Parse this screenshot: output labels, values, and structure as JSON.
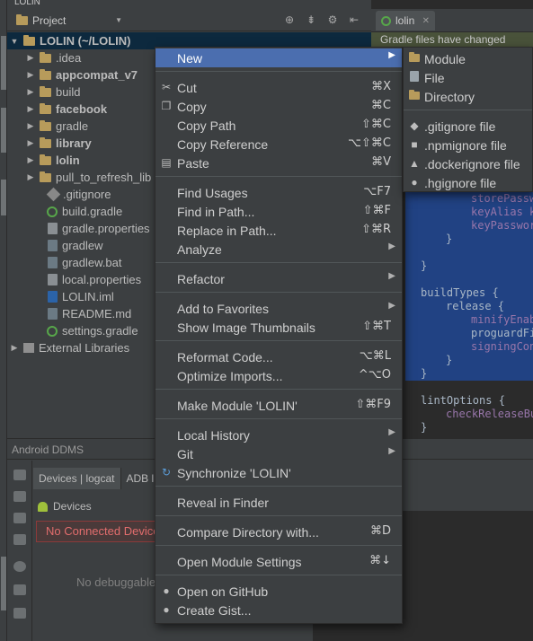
{
  "window_title": "LOLIN",
  "project_panel": {
    "view_selector": "Project",
    "tree": [
      {
        "label": "LOLIN (~/LOLIN)",
        "type": "root",
        "expanded": true
      },
      {
        "label": ".idea",
        "type": "folder"
      },
      {
        "label": "appcompat_v7",
        "type": "module"
      },
      {
        "label": "build",
        "type": "folder"
      },
      {
        "label": "facebook",
        "type": "module"
      },
      {
        "label": "gradle",
        "type": "folder"
      },
      {
        "label": "library",
        "type": "module"
      },
      {
        "label": "lolin",
        "type": "module"
      },
      {
        "label": "pull_to_refresh_lib",
        "type": "folder"
      },
      {
        "label": ".gitignore",
        "type": "git"
      },
      {
        "label": "build.gradle",
        "type": "gradle"
      },
      {
        "label": "gradle.properties",
        "type": "properties"
      },
      {
        "label": "gradlew",
        "type": "file"
      },
      {
        "label": "gradlew.bat",
        "type": "file"
      },
      {
        "label": "local.properties",
        "type": "properties"
      },
      {
        "label": "LOLIN.iml",
        "type": "iml"
      },
      {
        "label": "README.md",
        "type": "file"
      },
      {
        "label": "settings.gradle",
        "type": "gradle"
      },
      {
        "label": "External Libraries",
        "type": "libraries"
      }
    ]
  },
  "editor": {
    "tab_label": "lolin",
    "banner": "Gradle files have changed",
    "code_lines": [
      {
        "text": "storePassw",
        "style": "purple"
      },
      {
        "text": "keyAlias k",
        "style": "purple"
      },
      {
        "text": "keyPasswor",
        "style": "purple"
      },
      {
        "text": "}",
        "style": "plain"
      },
      {
        "text": "}",
        "style": "plain"
      },
      {
        "text": "buildTypes {",
        "style": "plain"
      },
      {
        "text": "release {",
        "style": "plain"
      },
      {
        "text": "minifyEnab",
        "style": "purple"
      },
      {
        "text": "proguardFi",
        "style": "plain"
      },
      {
        "text": "signingCon",
        "style": "purple"
      },
      {
        "text": "}",
        "style": "plain"
      },
      {
        "text": "}",
        "style": "plain"
      },
      {
        "text": "lintOptions {",
        "style": "plain"
      },
      {
        "text": "checkReleaseBu",
        "style": "purple"
      },
      {
        "text": "}",
        "style": "plain"
      }
    ]
  },
  "ddms": {
    "title": "Android DDMS",
    "tabs": [
      "Devices | logcat",
      "ADB l"
    ],
    "devices_header": "Devices",
    "no_device": "No Connected Devices",
    "no_debuggable": "No debuggable"
  },
  "context_menu": {
    "items": [
      {
        "label": "New",
        "submenu": true,
        "selected": true
      },
      {
        "label": "Cut",
        "shortcut": "⌘X",
        "icon": "✂"
      },
      {
        "label": "Copy",
        "shortcut": "⌘C",
        "icon": "❐"
      },
      {
        "label": "Copy Path",
        "shortcut": "⇧⌘C"
      },
      {
        "label": "Copy Reference",
        "shortcut": "⌥⇧⌘C"
      },
      {
        "label": "Paste",
        "shortcut": "⌘V",
        "icon": "📋"
      },
      {
        "label": "Find Usages",
        "shortcut": "⌥F7"
      },
      {
        "label": "Find in Path...",
        "shortcut": "⇧⌘F"
      },
      {
        "label": "Replace in Path...",
        "shortcut": "⇧⌘R"
      },
      {
        "label": "Analyze",
        "submenu": true
      },
      {
        "label": "Refactor",
        "submenu": true
      },
      {
        "label": "Add to Favorites",
        "submenu": true
      },
      {
        "label": "Show Image Thumbnails",
        "shortcut": "⇧⌘T"
      },
      {
        "label": "Reformat Code...",
        "shortcut": "⌥⌘L"
      },
      {
        "label": "Optimize Imports...",
        "shortcut": "^⌥O"
      },
      {
        "label": "Make Module 'LOLIN'",
        "shortcut": "⇧⌘F9"
      },
      {
        "label": "Local History",
        "submenu": true
      },
      {
        "label": "Git",
        "submenu": true
      },
      {
        "label": "Synchronize 'LOLIN'",
        "icon": "↻"
      },
      {
        "label": "Reveal in Finder"
      },
      {
        "label": "Compare Directory with...",
        "shortcut": "⌘D"
      },
      {
        "label": "Open Module Settings",
        "shortcut": "⌘↓"
      },
      {
        "label": "Open on GitHub",
        "icon": "●"
      },
      {
        "label": "Create Gist...",
        "icon": "●"
      }
    ]
  },
  "new_submenu": {
    "items": [
      {
        "label": "Module",
        "icon": "module-icon"
      },
      {
        "label": "File",
        "icon": "file-icon"
      },
      {
        "label": "Directory",
        "icon": "directory-icon"
      },
      {
        "label": ".gitignore file",
        "icon": "git-icon"
      },
      {
        "label": ".npmignore file",
        "icon": "npm-icon"
      },
      {
        "label": ".dockerignore file",
        "icon": "docker-icon"
      },
      {
        "label": ".hgignore file",
        "icon": "hg-icon"
      }
    ]
  }
}
